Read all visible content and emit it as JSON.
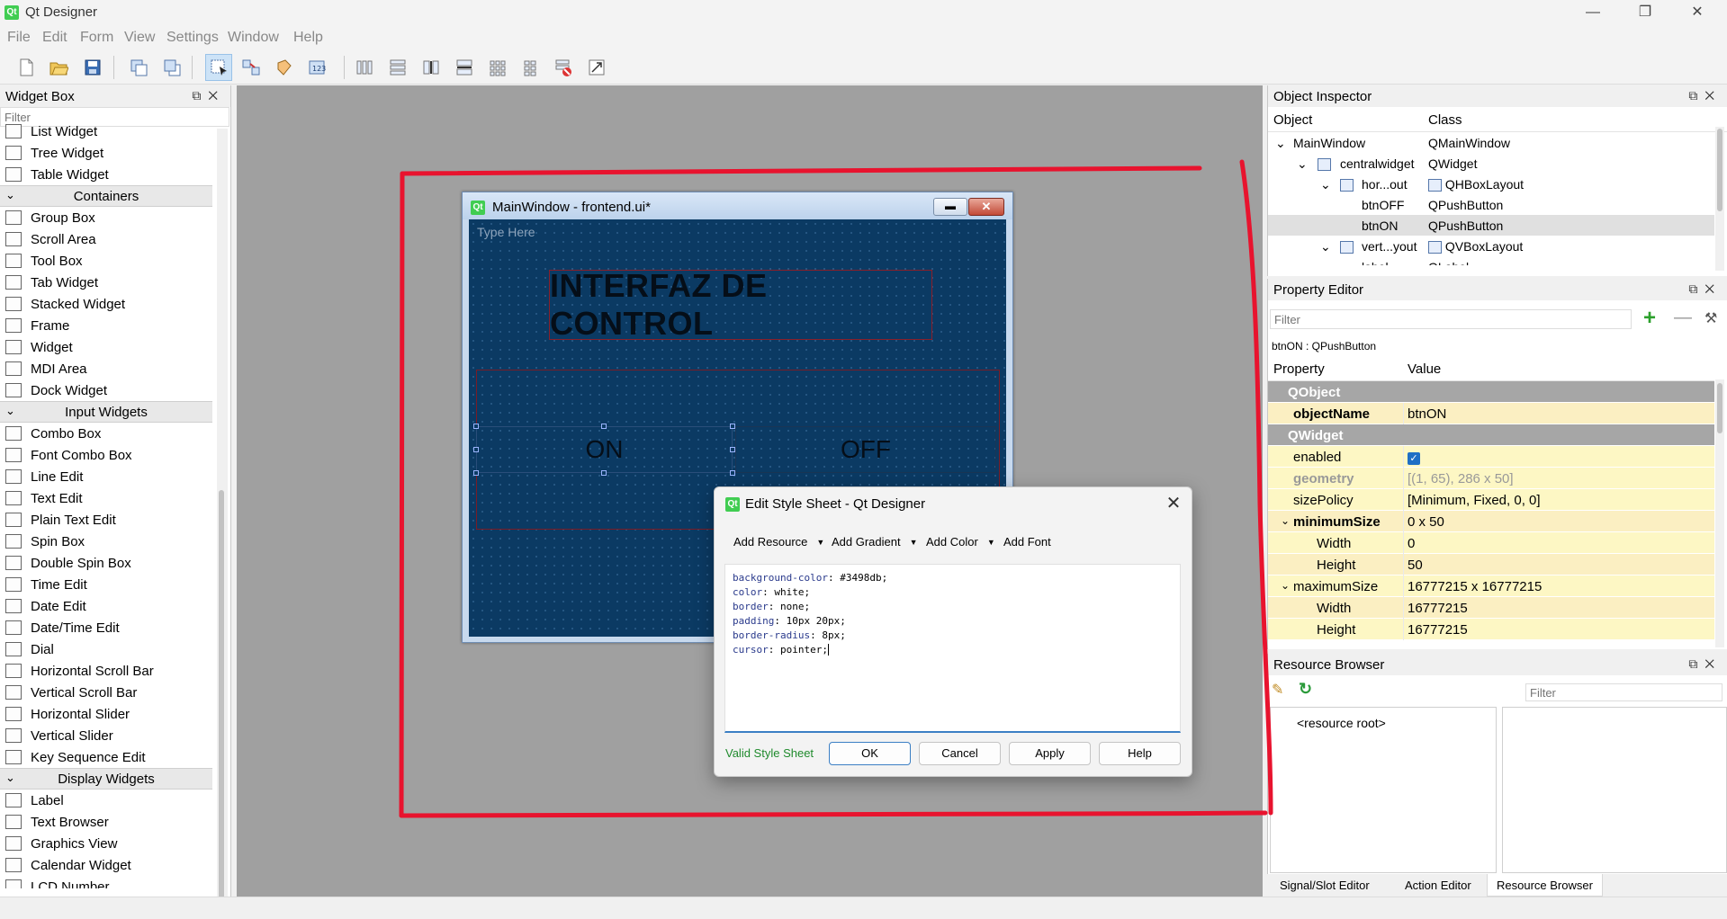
{
  "app": {
    "title": "Qt Designer"
  },
  "menu": [
    "File",
    "Edit",
    "Form",
    "View",
    "Settings",
    "Window",
    "Help"
  ],
  "widget_box": {
    "title": "Widget Box",
    "filter_placeholder": "Filter",
    "rows": [
      {
        "type": "item",
        "label": "List Widget",
        "icon": "list-widget-icon"
      },
      {
        "type": "item",
        "label": "Tree Widget",
        "icon": "tree-widget-icon"
      },
      {
        "type": "item",
        "label": "Table Widget",
        "icon": "table-widget-icon"
      },
      {
        "type": "cat",
        "label": "Containers"
      },
      {
        "type": "item",
        "label": "Group Box",
        "icon": "group-box-icon"
      },
      {
        "type": "item",
        "label": "Scroll Area",
        "icon": "scroll-area-icon"
      },
      {
        "type": "item",
        "label": "Tool Box",
        "icon": "tool-box-icon"
      },
      {
        "type": "item",
        "label": "Tab Widget",
        "icon": "tab-widget-icon"
      },
      {
        "type": "item",
        "label": "Stacked Widget",
        "icon": "stacked-widget-icon"
      },
      {
        "type": "item",
        "label": "Frame",
        "icon": "frame-icon"
      },
      {
        "type": "item",
        "label": "Widget",
        "icon": "widget-icon"
      },
      {
        "type": "item",
        "label": "MDI Area",
        "icon": "mdi-area-icon"
      },
      {
        "type": "item",
        "label": "Dock Widget",
        "icon": "dock-widget-icon"
      },
      {
        "type": "cat",
        "label": "Input Widgets"
      },
      {
        "type": "item",
        "label": "Combo Box",
        "icon": "combo-box-icon"
      },
      {
        "type": "item",
        "label": "Font Combo Box",
        "icon": "font-combo-box-icon"
      },
      {
        "type": "item",
        "label": "Line Edit",
        "icon": "line-edit-icon"
      },
      {
        "type": "item",
        "label": "Text Edit",
        "icon": "text-edit-icon"
      },
      {
        "type": "item",
        "label": "Plain Text Edit",
        "icon": "plain-text-edit-icon"
      },
      {
        "type": "item",
        "label": "Spin Box",
        "icon": "spin-box-icon"
      },
      {
        "type": "item",
        "label": "Double Spin Box",
        "icon": "double-spin-box-icon"
      },
      {
        "type": "item",
        "label": "Time Edit",
        "icon": "time-edit-icon"
      },
      {
        "type": "item",
        "label": "Date Edit",
        "icon": "date-edit-icon"
      },
      {
        "type": "item",
        "label": "Date/Time Edit",
        "icon": "date-time-edit-icon"
      },
      {
        "type": "item",
        "label": "Dial",
        "icon": "dial-icon"
      },
      {
        "type": "item",
        "label": "Horizontal Scroll Bar",
        "icon": "horizontal-scroll-bar-icon"
      },
      {
        "type": "item",
        "label": "Vertical Scroll Bar",
        "icon": "vertical-scroll-bar-icon"
      },
      {
        "type": "item",
        "label": "Horizontal Slider",
        "icon": "horizontal-slider-icon"
      },
      {
        "type": "item",
        "label": "Vertical Slider",
        "icon": "vertical-slider-icon"
      },
      {
        "type": "item",
        "label": "Key Sequence Edit",
        "icon": "key-sequence-edit-icon"
      },
      {
        "type": "cat",
        "label": "Display Widgets"
      },
      {
        "type": "item",
        "label": "Label",
        "icon": "label-icon"
      },
      {
        "type": "item",
        "label": "Text Browser",
        "icon": "text-browser-icon"
      },
      {
        "type": "item",
        "label": "Graphics View",
        "icon": "graphics-view-icon"
      },
      {
        "type": "item",
        "label": "Calendar Widget",
        "icon": "calendar-widget-icon"
      },
      {
        "type": "item",
        "label": "LCD Number",
        "icon": "lcd-number-icon"
      }
    ]
  },
  "form_window": {
    "title": "MainWindow - frontend.ui*",
    "menu_placeholder": "Type Here",
    "heading": "INTERFAZ DE CONTROL",
    "btn_on": "ON",
    "btn_off": "OFF"
  },
  "dialog": {
    "title": "Edit Style Sheet - Qt Designer",
    "menus": [
      "Add Resource",
      "Add Gradient",
      "Add Color",
      "Add Font"
    ],
    "css_lines": [
      {
        "prop": "background-color",
        "val": " #3498db;"
      },
      {
        "prop": " color",
        "val": " white;"
      },
      {
        "prop": " border",
        "val": " none;"
      },
      {
        "prop": " padding",
        "val": " 10px 20px;"
      },
      {
        "prop": " border-radius",
        "val": " 8px;"
      },
      {
        "prop": " cursor",
        "val": " pointer;"
      }
    ],
    "status": "Valid Style Sheet",
    "buttons": {
      "ok": "OK",
      "cancel": "Cancel",
      "apply": "Apply",
      "help": "Help"
    }
  },
  "object_inspector": {
    "title": "Object Inspector",
    "col_object": "Object",
    "col_class": "Class",
    "rows": [
      {
        "object": "MainWindow",
        "class": "QMainWindow"
      },
      {
        "object": "centralwidget",
        "class": "QWidget"
      },
      {
        "object": "hor...out",
        "class": "QHBoxLayout"
      },
      {
        "object": "btnOFF",
        "class": "QPushButton"
      },
      {
        "object": "btnON",
        "class": "QPushButton"
      },
      {
        "object": "vert...yout",
        "class": "QVBoxLayout"
      },
      {
        "object": "label",
        "class": "QLabel"
      }
    ]
  },
  "property_editor": {
    "title": "Property Editor",
    "filter_placeholder": "Filter",
    "object_label": "btnON : QPushButton",
    "col_property": "Property",
    "col_value": "Value",
    "rows": {
      "qobject": "QObject",
      "objectName": {
        "k": "objectName",
        "v": "btnON"
      },
      "qwidget": "QWidget",
      "enabled": {
        "k": "enabled",
        "v": "✓"
      },
      "geometry": {
        "k": "geometry",
        "v": "[(1, 65), 286 x 50]"
      },
      "sizePolicy": {
        "k": "sizePolicy",
        "v": "[Minimum, Fixed, 0, 0]"
      },
      "minimumSize": {
        "k": "minimumSize",
        "v": "0 x 50"
      },
      "minWidth": {
        "k": "Width",
        "v": "0"
      },
      "minHeight": {
        "k": "Height",
        "v": "50"
      },
      "maximumSize": {
        "k": "maximumSize",
        "v": "16777215 x 16777215"
      },
      "maxWidth": {
        "k": "Width",
        "v": "16777215"
      },
      "maxHeight": {
        "k": "Height",
        "v": "16777215"
      }
    }
  },
  "resource_browser": {
    "title": "Resource Browser",
    "filter_placeholder": "Filter",
    "root": "<resource root>"
  },
  "bottom_tabs": [
    "Signal/Slot Editor",
    "Action Editor",
    "Resource Browser"
  ],
  "colors": {
    "annotation": "#e8132e",
    "form_bg": "#0b3a63",
    "valid": "#1f8a2c"
  }
}
